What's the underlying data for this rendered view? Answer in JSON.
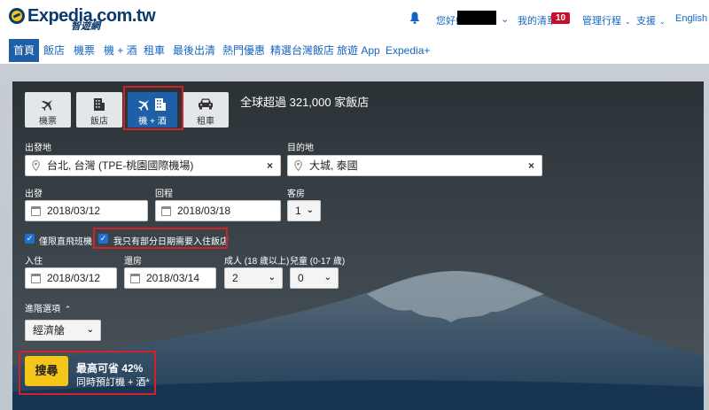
{
  "header": {
    "logo_text": "Expedia.com.tw",
    "logo_subtext": "智遊網",
    "greeting": "您好!",
    "my_list": "我的清單",
    "my_list_count": "10",
    "manage_trips": "管理行程",
    "support": "支援",
    "language": "English"
  },
  "nav": {
    "items": [
      "首頁",
      "飯店",
      "機票",
      "機 + 酒",
      "租車",
      "最後出清",
      "熱門優惠",
      "精選台灣飯店",
      "旅遊 App",
      "Expedia+"
    ],
    "active_index": 0
  },
  "search": {
    "tabs": [
      {
        "label": "機票",
        "icon": "plane-icon"
      },
      {
        "label": "飯店",
        "icon": "hotel-icon"
      },
      {
        "label": "機 + 酒",
        "icon": "plane-hotel-icon"
      },
      {
        "label": "租車",
        "icon": "car-icon"
      }
    ],
    "active_tab": 2,
    "headline": "全球超過 321,000 家飯店",
    "origin": {
      "label": "出發地",
      "value": "台北, 台灣 (TPE-桃園國際機場)"
    },
    "destination": {
      "label": "目的地",
      "value": "大城, 泰國"
    },
    "depart": {
      "label": "出發",
      "value": "2018/03/12"
    },
    "return": {
      "label": "回程",
      "value": "2018/03/18"
    },
    "rooms": {
      "label": "客房",
      "value": "1"
    },
    "direct_only": {
      "label": "僅限直飛班機",
      "checked": true
    },
    "partial_hotel": {
      "label": "我只有部分日期需要入住飯店",
      "checked": true
    },
    "checkin": {
      "label": "入住",
      "value": "2018/03/12"
    },
    "checkout": {
      "label": "還房",
      "value": "2018/03/14"
    },
    "adults": {
      "label": "成人 (18 歲以上)",
      "value": "2"
    },
    "children": {
      "label": "兒童 (0-17 歲)",
      "value": "0"
    },
    "advanced": {
      "label": "進階選項",
      "chevron": "⌃"
    },
    "cabin": {
      "value": "經濟艙"
    },
    "search_button": "搜尋",
    "promo_line1": "最高可省 42%",
    "promo_line2": "同時預訂機 + 酒*"
  },
  "colors": {
    "brand_navy": "#0a3a6b",
    "link_blue": "#1565c0",
    "active_blue": "#1f5fa8",
    "search_yellow": "#f6c519",
    "highlight_red": "#d42028",
    "badge_red": "#c8102e"
  }
}
